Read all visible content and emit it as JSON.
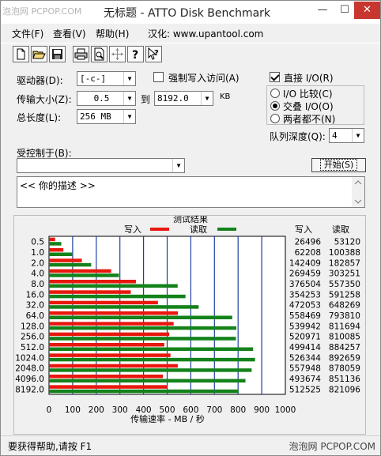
{
  "watermark_top": "泡泡网 PCPOP.COM",
  "title": "无标题 - ATTO Disk Benchmark",
  "window_buttons": {
    "minimize": "—",
    "maximize": "☐",
    "close": "✕"
  },
  "menu": [
    "文件(F)",
    "查看(V)",
    "帮助(H)",
    "汉化: www.upantool.com"
  ],
  "toolbar_icons": [
    "new-file-icon",
    "open-folder-icon",
    "save-icon",
    "print-icon",
    "print-preview-icon",
    "move-icon",
    "help-icon",
    "context-help-icon"
  ],
  "controls": {
    "drive_label": "驱动器(D):",
    "drive_value": "[-c-]",
    "force_write_label": "强制写入访问(A)",
    "force_write_checked": false,
    "direct_io_label": "直接 I/O(R)",
    "direct_io_checked": true,
    "transfer_label": "传输大小(Z):",
    "transfer_from": "0.5",
    "to_label": "到",
    "transfer_to": "8192.0",
    "kb_label": "KB",
    "length_label": "总长度(L):",
    "length_value": "256 MB",
    "io_compare_label": "I/O 比较(C)",
    "overlapped_io_label": "交叠 I/O(O)",
    "neither_label": "两者都不(N)",
    "selected_mode": "overlapped",
    "queue_label": "队列深度(Q):",
    "queue_value": "4",
    "controlled_by_label": "受控制于(B):",
    "controlled_by_value": "",
    "start_button": "开始(S)",
    "description": "<<   你的描述    >>"
  },
  "chart_data": {
    "type": "bar",
    "title": "测试结果",
    "legend": {
      "write": "写入",
      "read": "读取"
    },
    "xlabel": "传输速率 - MB / 秒",
    "xlim": [
      0,
      1000
    ],
    "xticks": [
      "0",
      "100",
      "200",
      "300",
      "400",
      "500",
      "600",
      "700",
      "800",
      "900",
      "1000"
    ],
    "write_color": "#e8180e",
    "read_color": "#14821a",
    "col_headers": {
      "write": "写入",
      "read": "读取"
    },
    "categories": [
      "0.5",
      "1.0",
      "2.0",
      "4.0",
      "8.0",
      "16.0",
      "32.0",
      "64.0",
      "128.0",
      "256.0",
      "512.0",
      "1024.0",
      "2048.0",
      "4096.0",
      "8192.0"
    ],
    "write_values": [
      26496,
      62208,
      142409,
      269459,
      376504,
      354253,
      472053,
      558469,
      539942,
      520971,
      499414,
      526344,
      557948,
      493674,
      512525
    ],
    "read_values": [
      53120,
      100388,
      182857,
      303251,
      557350,
      591258,
      648269,
      793810,
      811694,
      810085,
      884257,
      892659,
      878059,
      851136,
      821096
    ]
  },
  "status": "要获得帮助,请按 F1",
  "watermark_bottom": "泡泡网 PCPOP.COM"
}
